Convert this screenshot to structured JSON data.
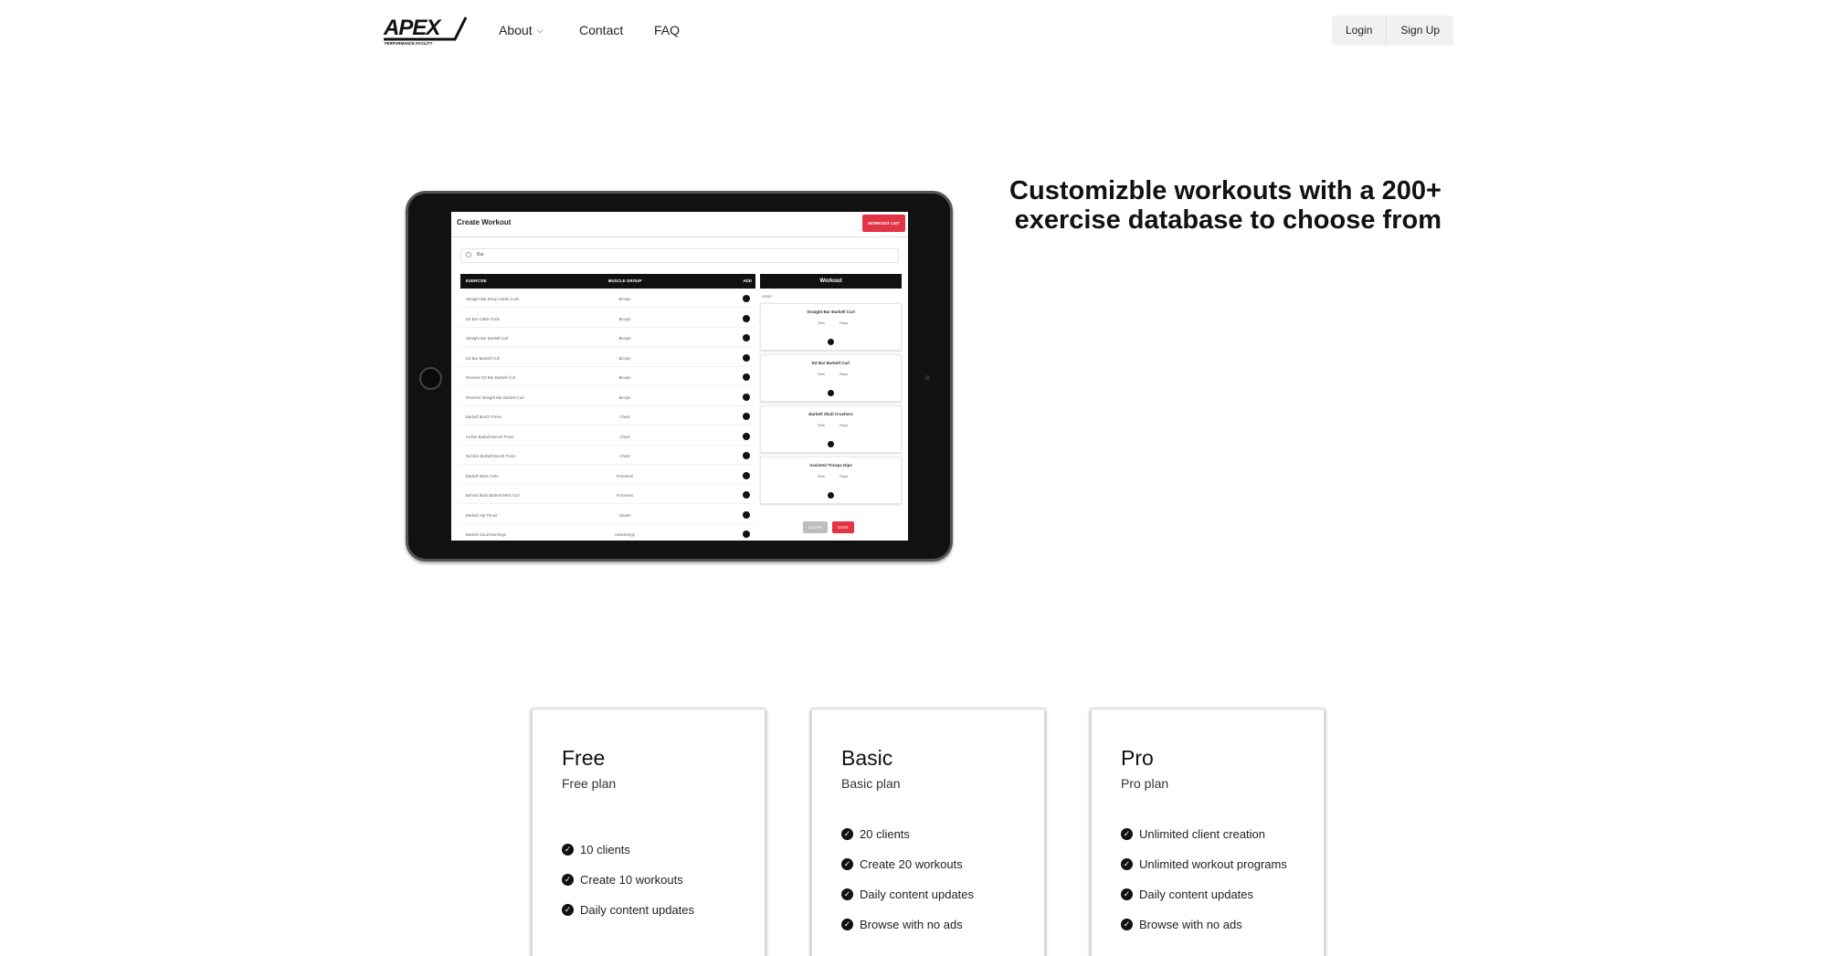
{
  "nav": {
    "logo_text": "APEX",
    "logo_tagline": "PERFORMANCE FACILITY",
    "about": "About",
    "contact": "Contact",
    "faq": "FAQ",
    "login": "Login",
    "signup": "Sign Up"
  },
  "hero": {
    "headline": "Customizble workouts with a 200+ exercise database to choose from"
  },
  "tablet_screen": {
    "title": "Create Workout",
    "workout_list_button": "WORKOUT LIST",
    "search_value": "Bar",
    "table_headers": [
      "EXERCISE",
      "MUSCLE GROUP",
      "ADD"
    ],
    "exercises": [
      {
        "name": "Straight Bar Bicep Cable Curls",
        "group": "Biceps"
      },
      {
        "name": "EZ Bar Cable Curls",
        "group": "Biceps"
      },
      {
        "name": "Straight Bar Barbell Curl",
        "group": "Biceps"
      },
      {
        "name": "EZ Bar Barbell Curl",
        "group": "Biceps"
      },
      {
        "name": "Reverse EZ Bar Barbell Curl",
        "group": "Biceps"
      },
      {
        "name": "Reverse Straight Bar Barbell Curl",
        "group": "Biceps"
      },
      {
        "name": "Barbell Bench Press",
        "group": "Chest"
      },
      {
        "name": "Incline Barbell Bench Press",
        "group": "Chest"
      },
      {
        "name": "Decline Barbell Bench Press",
        "group": "Chest"
      },
      {
        "name": "Barbell Wrist Curls",
        "group": "Forearms"
      },
      {
        "name": "Behind Back Barbell Wrist Curl",
        "group": "Forearms"
      },
      {
        "name": "Barbell Hip Thrust",
        "group": "Glutes"
      },
      {
        "name": "Barbell Good Mornings",
        "group": "Hamstrings"
      }
    ],
    "workout_header": "Workout",
    "workout_name": "Arms",
    "sets_label": "Sets",
    "reps_label": "Reps",
    "workout_items": [
      "Straight Bar Barbell Curl",
      "EZ Bar Barbell Curl",
      "Barbell Skull Crushers",
      "Assisted Triceps Dips"
    ],
    "clear_button": "CLEAR",
    "save_button": "SAVE"
  },
  "plans": [
    {
      "name": "Free",
      "subtitle": "Free plan",
      "features": [
        "10 clients",
        "Create 10 workouts",
        "Daily content updates"
      ]
    },
    {
      "name": "Basic",
      "subtitle": "Basic plan",
      "features": [
        "20 clients",
        "Create 20 workouts",
        "Daily content updates",
        "Browse with no ads"
      ]
    },
    {
      "name": "Pro",
      "subtitle": "Pro plan",
      "features": [
        "Unlimited client creation",
        "Unlimited workout programs",
        "Daily content updates",
        "Browse with no ads"
      ]
    }
  ]
}
